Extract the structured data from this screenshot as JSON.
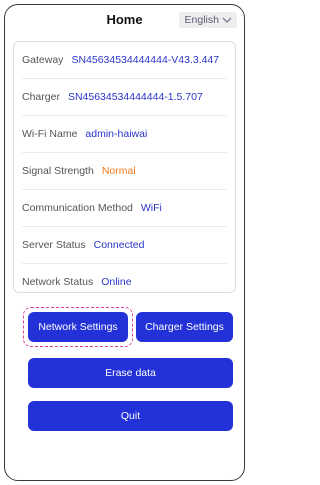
{
  "header": {
    "title": "Home",
    "language": "English",
    "language_icon": "chevron-down-icon"
  },
  "status": {
    "gateway_label": "Gateway",
    "gateway_value": "SN45634534444444-V43.3.447",
    "charger_label": "Charger",
    "charger_value": "SN45634534444444-1.5.707",
    "wifi_label": "Wi-Fi Name",
    "wifi_value": "admin-haiwai",
    "signal_label": "Signal Strength",
    "signal_value": "Normal",
    "comm_label": "Communication Method",
    "comm_value": "WiFi",
    "server_label": "Server Status",
    "server_value": "Connected",
    "network_label": "Network Status",
    "network_value": "Online"
  },
  "actions": {
    "network_settings": "Network Settings",
    "charger_settings": "Charger Settings",
    "erase_data": "Erase data",
    "quit": "Quit"
  },
  "colors": {
    "primary": "#2232d8",
    "value_text": "#2a35c9",
    "warning": "#f07a1a",
    "focus_ring": "#e0449a"
  }
}
